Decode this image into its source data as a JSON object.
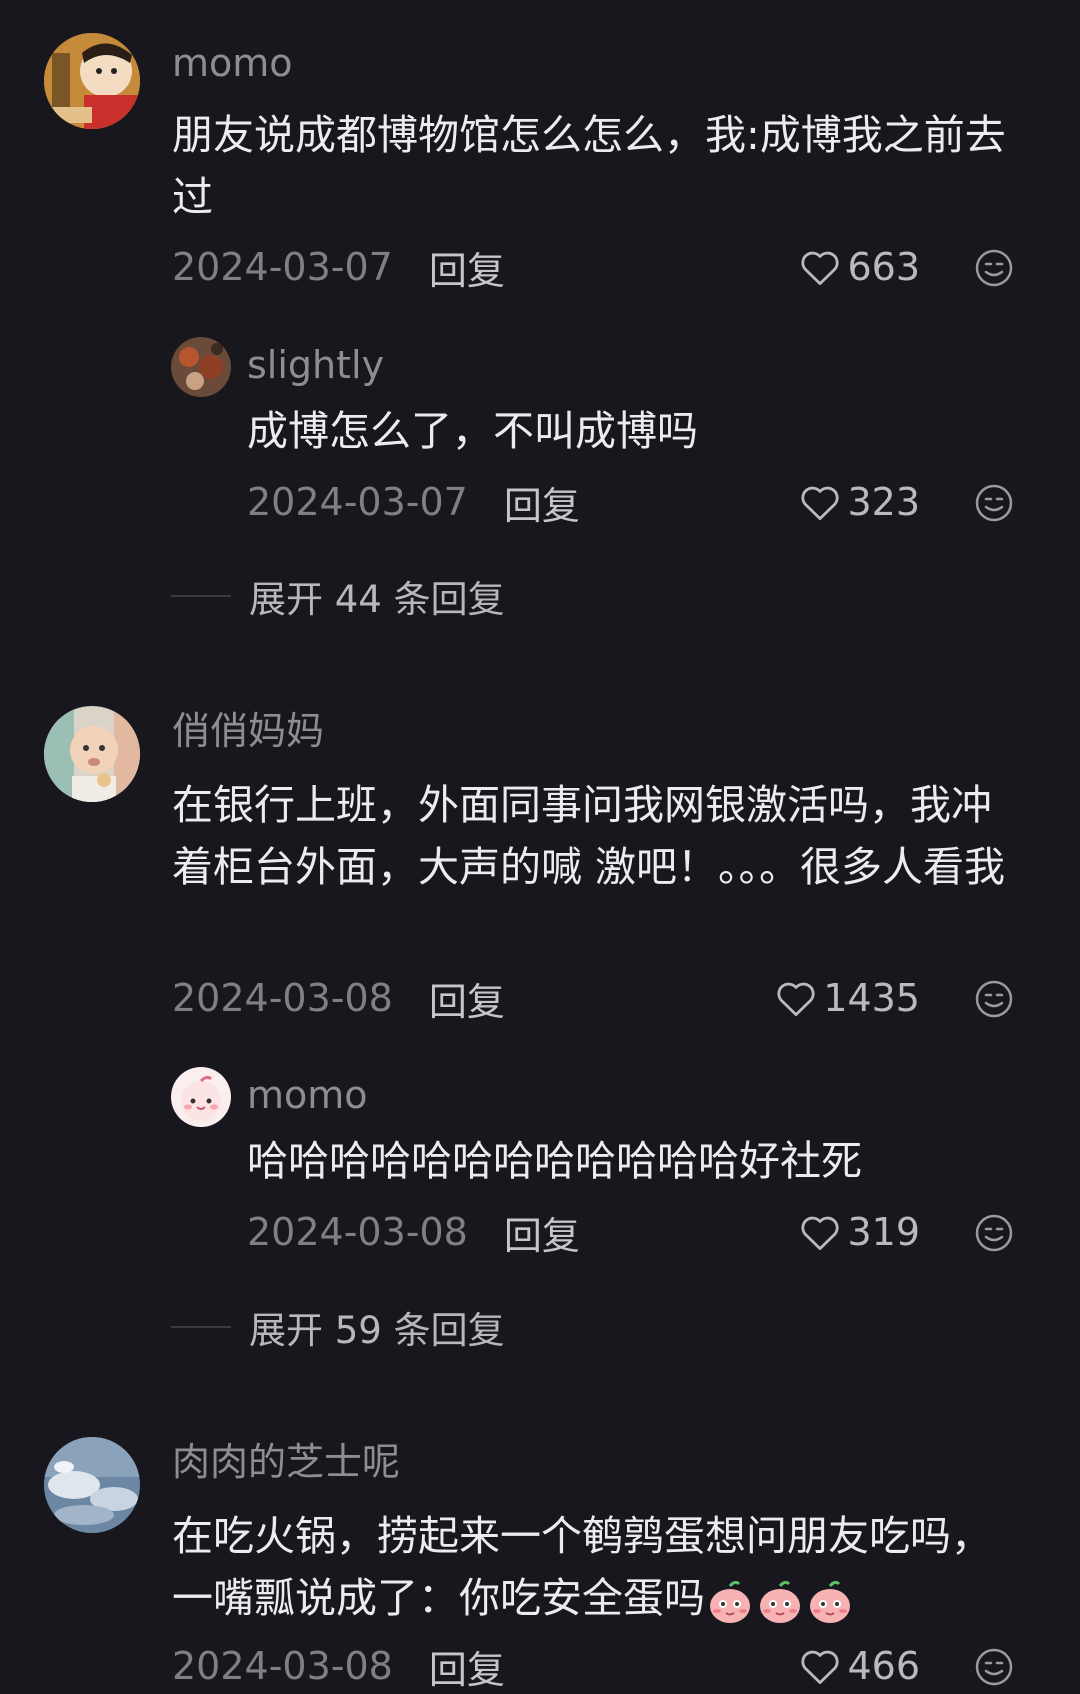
{
  "comments": [
    {
      "username": "momo",
      "text": "朋友说成都博物馆怎么怎么，我:成博我之前去过",
      "date": "2024-03-07",
      "reply_label": "回复",
      "likes": "663",
      "replies": [
        {
          "username": "slightly",
          "text": "成博怎么了，不叫成博吗",
          "date": "2024-03-07",
          "reply_label": "回复",
          "likes": "323"
        }
      ],
      "expand_label": "展开 44 条回复"
    },
    {
      "username": "俏俏妈妈",
      "text": "在银行上班，外面同事问我网银激活吗，我冲着柜台外面，大声的喊 激吧！。。。很多人看我",
      "date": "2024-03-08",
      "reply_label": "回复",
      "likes": "1435",
      "replies": [
        {
          "username": "momo",
          "text": "哈哈哈哈哈哈哈哈哈哈哈哈好社死",
          "date": "2024-03-08",
          "reply_label": "回复",
          "likes": "319"
        }
      ],
      "expand_label": "展开 59 条回复"
    },
    {
      "username": "肉肉的芝士呢",
      "text": "在吃火锅，捞起来一个鹌鹑蛋想问朋友吃吗，一嘴瓢说成了：你吃安全蛋吗",
      "date": "2024-03-08",
      "reply_label": "回复",
      "likes": "466"
    }
  ],
  "colors": {
    "background": "#17171d",
    "username": "#8d8d94",
    "text": "#ececef",
    "date": "#7f7f86"
  },
  "icons": [
    "heart-icon",
    "emoji-face-icon",
    "peach-emoji-icon"
  ]
}
